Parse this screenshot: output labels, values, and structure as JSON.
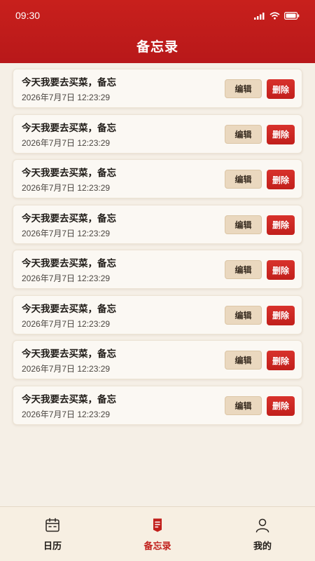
{
  "status_bar": {
    "time": "09:30"
  },
  "header": {
    "title": "备忘录"
  },
  "memos": [
    {
      "title": "今天我要去买菜，备忘",
      "time": "2026年7月7日 12:23:29"
    },
    {
      "title": "今天我要去买菜，备忘",
      "time": "2026年7月7日 12:23:29"
    },
    {
      "title": "今天我要去买菜，备忘",
      "time": "2026年7月7日 12:23:29"
    },
    {
      "title": "今天我要去买菜，备忘",
      "time": "2026年7月7日 12:23:29"
    },
    {
      "title": "今天我要去买菜，备忘",
      "time": "2026年7月7日 12:23:29"
    },
    {
      "title": "今天我要去买菜，备忘",
      "time": "2026年7月7日 12:23:29"
    },
    {
      "title": "今天我要去买菜，备忘",
      "time": "2026年7月7日 12:23:29"
    },
    {
      "title": "今天我要去买菜，备忘",
      "time": "2026年7月7日 12:23:29"
    }
  ],
  "actions": {
    "edit_label": "编辑",
    "delete_label": "删除"
  },
  "tabbar": {
    "items": [
      {
        "label": "日历",
        "icon": "calendar-icon",
        "active": false
      },
      {
        "label": "备忘录",
        "icon": "memo-icon",
        "active": true
      },
      {
        "label": "我的",
        "icon": "profile-icon",
        "active": false
      }
    ]
  },
  "colors": {
    "primary": "#c11f1b",
    "edit_button": "#ead8bf",
    "background": "#f5efe6"
  }
}
